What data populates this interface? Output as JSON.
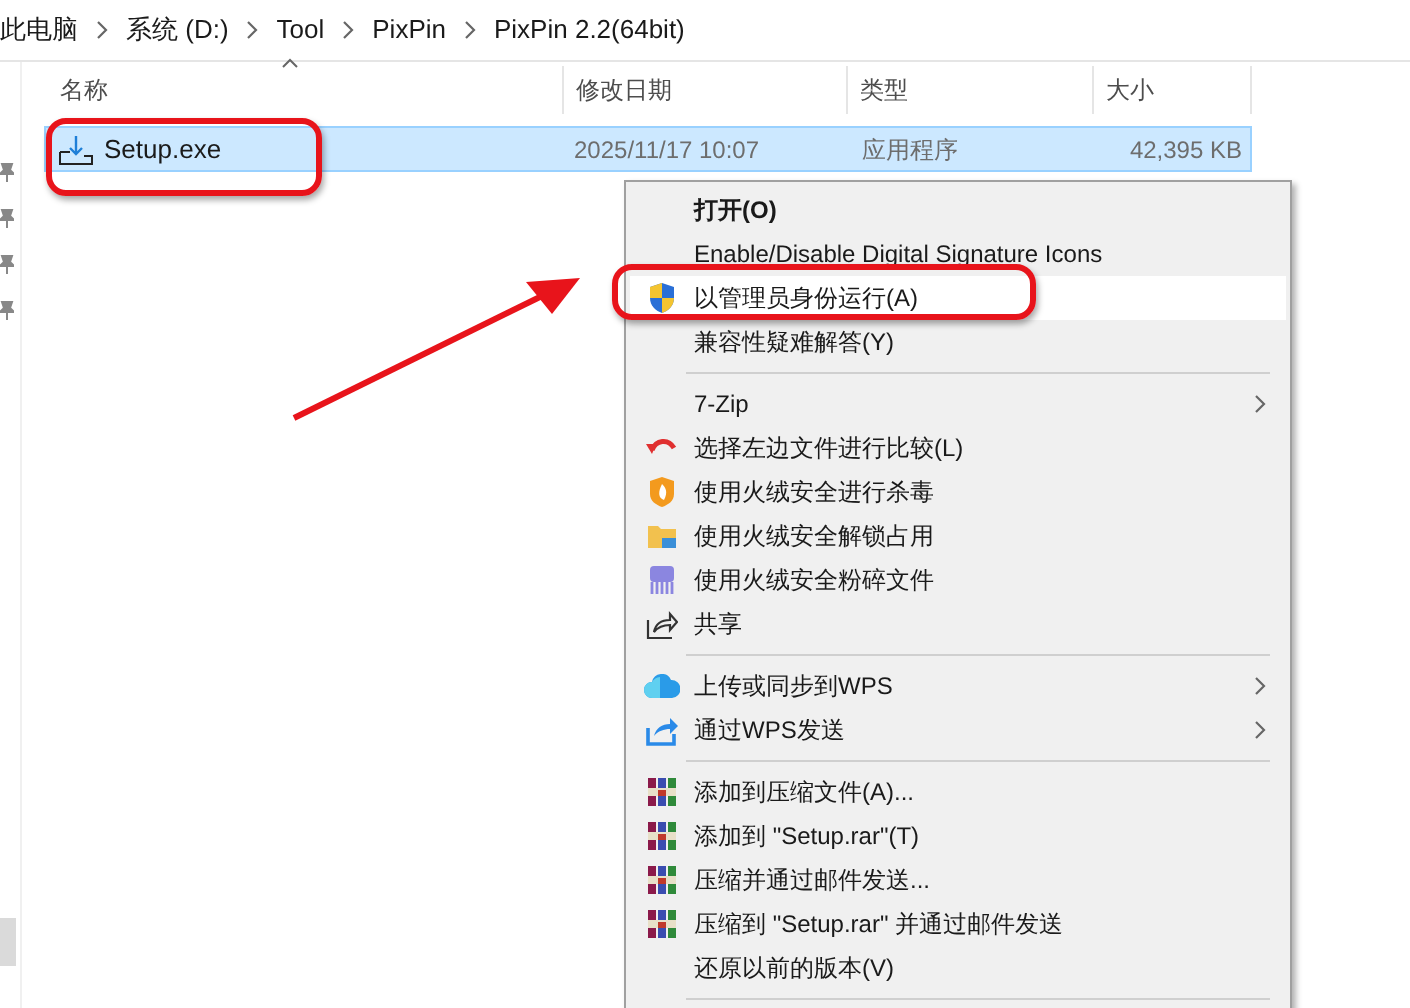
{
  "breadcrumb": [
    "此电脑",
    "系统 (D:)",
    "Tool",
    "PixPin",
    "PixPin 2.2(64bit)"
  ],
  "columns": [
    {
      "label": "名称",
      "sorted": true
    },
    {
      "label": "修改日期",
      "sorted": false
    },
    {
      "label": "类型",
      "sorted": false
    },
    {
      "label": "大小",
      "sorted": false
    }
  ],
  "files": [
    {
      "name": "Setup.exe",
      "modified": "2025/11/17 10:07",
      "type": "应用程序",
      "size": "42,395 KB",
      "selected": true
    }
  ],
  "context_menu": [
    {
      "kind": "item",
      "label": "打开(O)",
      "default": true,
      "submenu": false,
      "selected": false
    },
    {
      "kind": "item",
      "label": "Enable/Disable Digital Signature Icons",
      "default": false,
      "submenu": false,
      "selected": false
    },
    {
      "kind": "item",
      "label": "以管理员身份运行(A)",
      "default": false,
      "submenu": false,
      "selected": true
    },
    {
      "kind": "item",
      "label": "兼容性疑难解答(Y)",
      "default": false,
      "submenu": false,
      "selected": false
    },
    {
      "kind": "separator"
    },
    {
      "kind": "item",
      "label": "7-Zip",
      "default": false,
      "submenu": true,
      "selected": false
    },
    {
      "kind": "item",
      "label": "选择左边文件进行比较(L)",
      "default": false,
      "submenu": false,
      "selected": false
    },
    {
      "kind": "item",
      "label": "使用火绒安全进行杀毒",
      "default": false,
      "submenu": false,
      "selected": false
    },
    {
      "kind": "item",
      "label": "使用火绒安全解锁占用",
      "default": false,
      "submenu": false,
      "selected": false
    },
    {
      "kind": "item",
      "label": "使用火绒安全粉碎文件",
      "default": false,
      "submenu": false,
      "selected": false
    },
    {
      "kind": "item",
      "label": "共享",
      "default": false,
      "submenu": false,
      "selected": false
    },
    {
      "kind": "separator"
    },
    {
      "kind": "item",
      "label": "上传或同步到WPS",
      "default": false,
      "submenu": true,
      "selected": false
    },
    {
      "kind": "item",
      "label": "通过WPS发送",
      "default": false,
      "submenu": true,
      "selected": false
    },
    {
      "kind": "separator"
    },
    {
      "kind": "item",
      "label": "添加到压缩文件(A)...",
      "default": false,
      "submenu": false,
      "selected": false
    },
    {
      "kind": "item",
      "label": "添加到 \"Setup.rar\"(T)",
      "default": false,
      "submenu": false,
      "selected": false
    },
    {
      "kind": "item",
      "label": "压缩并通过邮件发送...",
      "default": false,
      "submenu": false,
      "selected": false
    },
    {
      "kind": "item",
      "label": "压缩到 \"Setup.rar\" 并通过邮件发送",
      "default": false,
      "submenu": false,
      "selected": false
    },
    {
      "kind": "item",
      "label": "还原以前的版本(V)",
      "default": false,
      "submenu": false,
      "selected": false
    },
    {
      "kind": "separator"
    }
  ]
}
